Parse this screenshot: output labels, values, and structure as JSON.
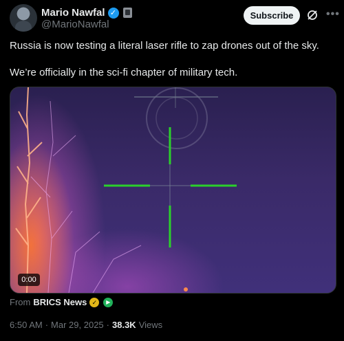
{
  "author": {
    "display_name": "Mario Nawfal",
    "handle": "@MarioNawfal"
  },
  "actions": {
    "subscribe_label": "Subscribe"
  },
  "tweet": {
    "line1": "Russia is now testing a literal laser rifle to zap drones out of the sky.",
    "line2": "We’re officially in the sci-fi chapter of military tech."
  },
  "media": {
    "duration": "0:00"
  },
  "source": {
    "from_label": "From",
    "name": "BRICS News"
  },
  "meta": {
    "time": "6:50 AM",
    "separator1": "·",
    "date": "Mar 29, 2025",
    "separator2": "·",
    "views_count": "38.3K",
    "views_label": "Views"
  },
  "colors": {
    "accent_verified": "#1d9bf0",
    "crosshair": "#2bd12b",
    "background": "#000000"
  },
  "icons": [
    "verified-badge-icon",
    "affiliate-badge-icon",
    "grok-icon",
    "more-icon",
    "gold-check-icon",
    "play-badge-icon"
  ]
}
